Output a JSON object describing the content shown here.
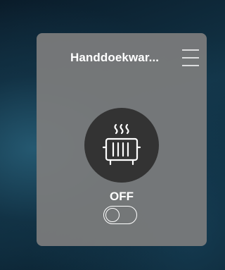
{
  "card": {
    "device_name": "Handdoekwar...",
    "state_label": "OFF",
    "toggle_on": false
  },
  "icons": {
    "menu": "menu-icon",
    "device": "towel-radiator-heating-icon"
  },
  "colors": {
    "card_bg": "#7d7d7d",
    "icon_circle_bg": "#333333",
    "foreground": "#ffffff"
  }
}
